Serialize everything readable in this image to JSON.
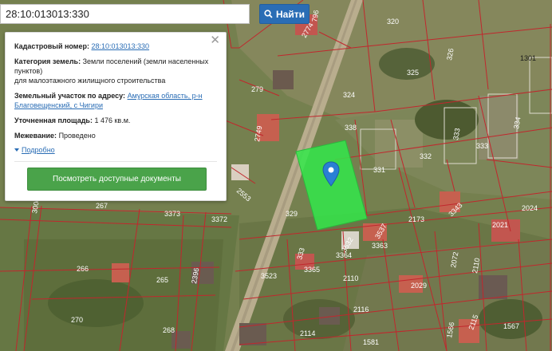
{
  "search": {
    "value": "28:10:013013:330",
    "button_label": "Найти"
  },
  "info_card": {
    "cadastral_label": "Кадастровый номер:",
    "cadastral_value": "28:10:013013:330",
    "category_label": "Категория земель:",
    "category_value": "Земли поселений (земли населенных пунктов)",
    "category_value_line2": "для малоэтажного жилищного строительства",
    "address_label": "Земельный участок по адресу:",
    "address_value": "Амурская область, р-н Благовещенский, с Чигири",
    "area_label": "Уточненная площадь:",
    "area_value": "1 476 кв.м.",
    "survey_label": "Межевание:",
    "survey_value": "Проведено",
    "more_label": "Подробно",
    "docs_button_label": "Посмотреть доступные документы"
  },
  "map": {
    "selected_parcel_color": "#33e84a",
    "boundary_color": "#c1272d",
    "marker_color": "#2a7fd4",
    "parcel_labels": [
      "796",
      "2774",
      "320",
      "326",
      "325",
      "1301",
      "279",
      "324",
      "2749",
      "338",
      "334",
      "333",
      "333",
      "2553",
      "332",
      "331",
      "267",
      "3373",
      "3372",
      "329",
      "2173",
      "3343",
      "2024",
      "2021",
      "3000/2",
      "3537",
      "3532",
      "3363",
      "3364",
      "333",
      "3365",
      "2110",
      "2072",
      "266",
      "265",
      "2396",
      "3523",
      "2110",
      "2029",
      "2116",
      "270",
      "268",
      "2114",
      "1581",
      "1567",
      "1566",
      "2115"
    ]
  }
}
